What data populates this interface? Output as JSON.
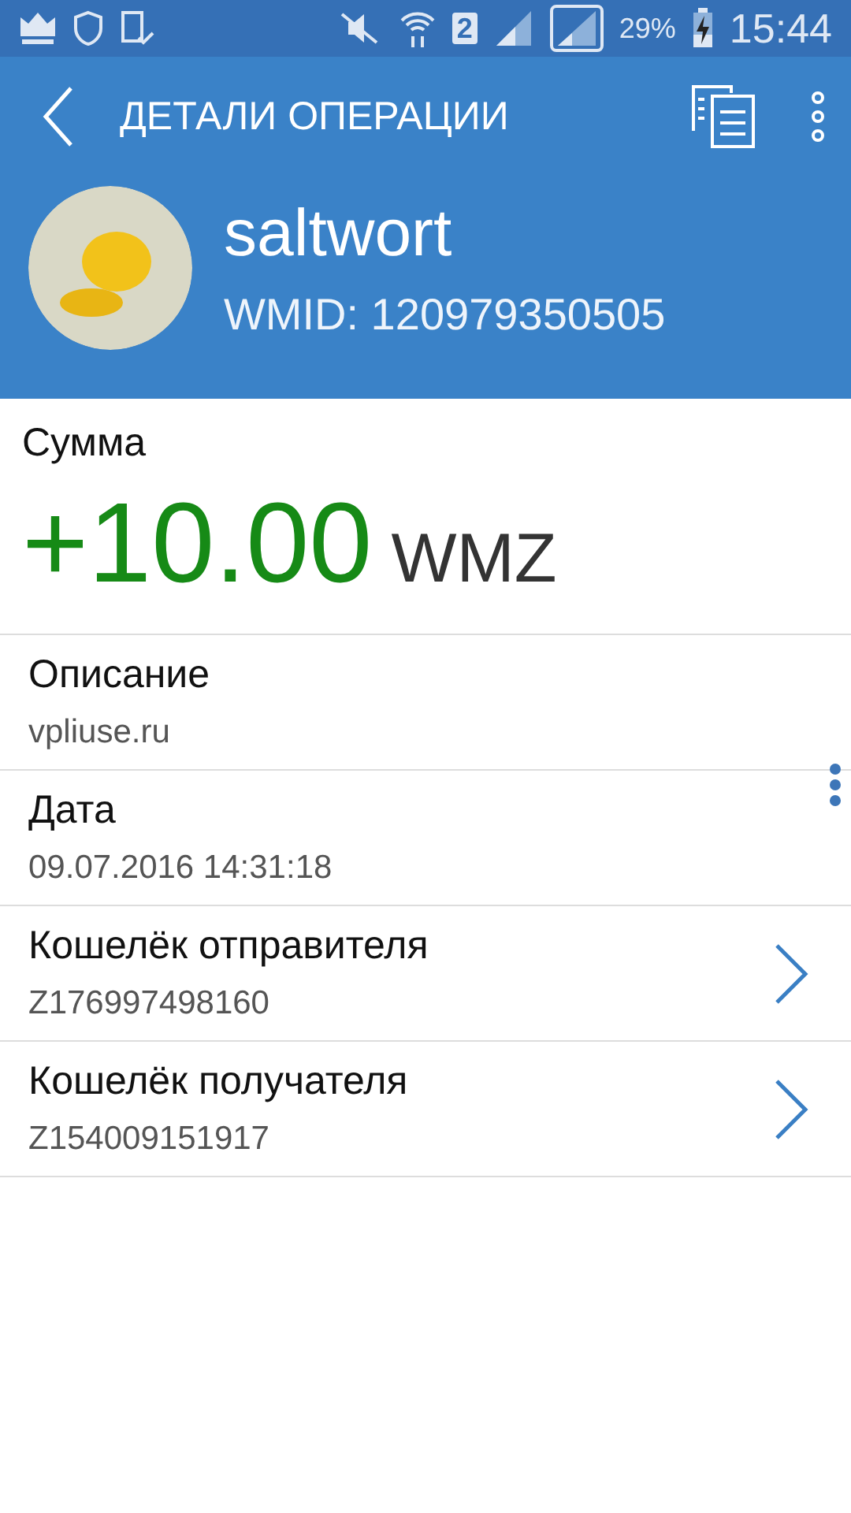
{
  "status_bar": {
    "sim_slot": "2",
    "battery": "29%",
    "time": "15:44"
  },
  "toolbar": {
    "title": "ДЕТАЛИ ОПЕРАЦИИ"
  },
  "profile": {
    "name": "saltwort",
    "wmid": "WMID: 120979350505"
  },
  "amount": {
    "label": "Сумма",
    "value": "+10.00",
    "currency": "WMZ"
  },
  "details": [
    {
      "kind": "text",
      "label": "Описание",
      "value": "vpliuse.ru"
    },
    {
      "kind": "text",
      "label": "Дата",
      "value": "09.07.2016 14:31:18"
    },
    {
      "kind": "link",
      "label": "Кошелёк отправителя",
      "value": "Z176997498160"
    },
    {
      "kind": "link",
      "label": "Кошелёк получателя",
      "value": "Z154009151917"
    }
  ]
}
